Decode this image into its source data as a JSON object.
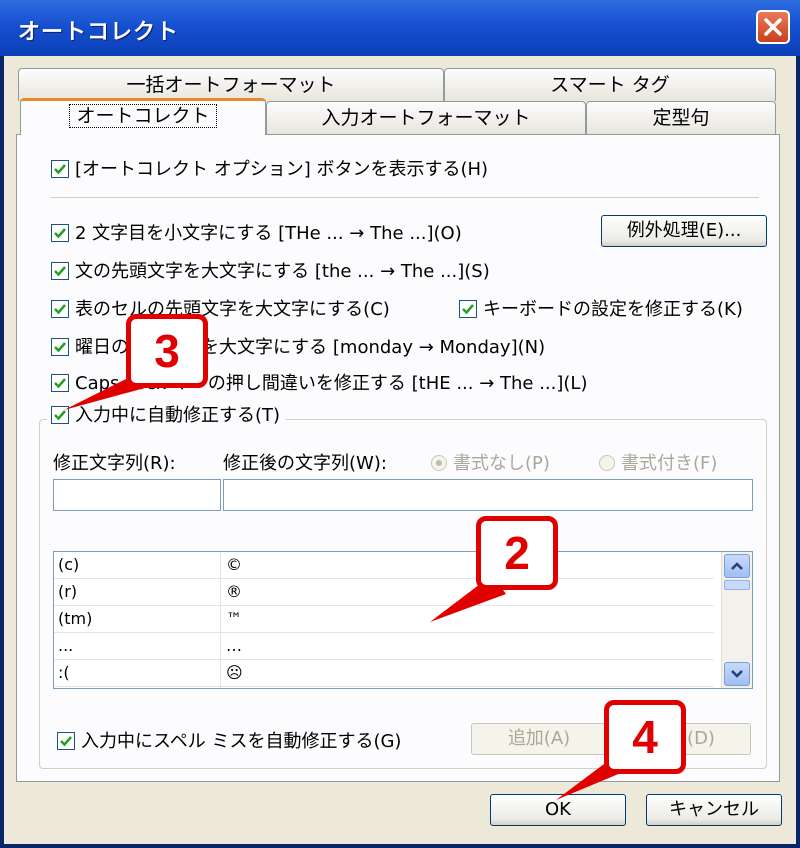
{
  "window": {
    "title": "オートコレクト"
  },
  "tabs": {
    "row1": [
      "一括オートフォーマット",
      "スマート タグ"
    ],
    "row2": [
      "オートコレクト",
      "入力オートフォーマット",
      "定型句"
    ]
  },
  "options": {
    "show_button": "[オートコレクト オプション] ボタンを表示する(H)",
    "two_initial": "2 文字目を小文字にする [THe ... → The ...](O)",
    "exceptions_button": "例外処理(E)...",
    "capitalize_sentence": "文の先頭文字を大文字にする [the ... → The ...](S)",
    "capitalize_table": "表のセルの先頭文字を大文字にする(C)",
    "keyboard_fix": "キーボードの設定を修正する(K)",
    "capitalize_days": "曜日の先頭文字を大文字にする [monday → Monday](N)",
    "caps_lock": "Caps Lock キーの押し間違いを修正する [tHE ... → The ...](L)",
    "replace_typing": "入力中に自動修正する(T)"
  },
  "replace": {
    "label_from": "修正文字列(R):",
    "label_to": "修正後の文字列(W):",
    "radio_plain": "書式なし(P)",
    "radio_formatted": "書式付き(F)",
    "rows": [
      {
        "from": "(c)",
        "to": "©"
      },
      {
        "from": "(r)",
        "to": "®"
      },
      {
        "from": "(tm)",
        "to": "™"
      },
      {
        "from": "...",
        "to": "…"
      },
      {
        "from": ":(",
        "to": "☹"
      }
    ]
  },
  "spell": {
    "label": "入力中にスペル ミスを自動修正する(G)",
    "add_button": "追加(A)",
    "delete_button": "削除(D)"
  },
  "buttons": {
    "ok": "OK",
    "cancel": "キャンセル"
  },
  "callouts": [
    "2",
    "3",
    "4"
  ]
}
